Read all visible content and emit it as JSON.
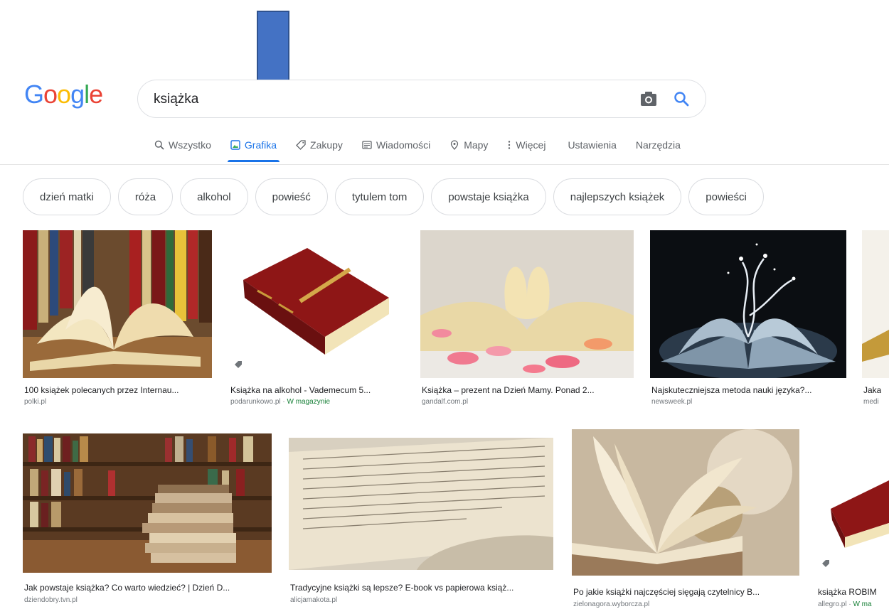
{
  "logo": {
    "text": "Google"
  },
  "search": {
    "value": "książka"
  },
  "tabs": [
    {
      "label": "Wszystko",
      "icon": "search-icon"
    },
    {
      "label": "Grafika",
      "icon": "image-icon"
    },
    {
      "label": "Zakupy",
      "icon": "tag-icon"
    },
    {
      "label": "Wiadomości",
      "icon": "news-icon"
    },
    {
      "label": "Mapy",
      "icon": "map-pin-icon"
    },
    {
      "label": "Więcej",
      "icon": "more-vert-icon"
    },
    {
      "label": "Ustawienia"
    },
    {
      "label": "Narzędzia"
    }
  ],
  "chips": [
    "dzień matki",
    "róża",
    "alkohol",
    "powieść",
    "tytulem tom",
    "powstaje książka",
    "najlepszych książek",
    "powieści"
  ],
  "results": [
    {
      "title": "100 książek polecanych przez Internau...",
      "source": "polki.pl",
      "stock": ""
    },
    {
      "title": "Książka na alkohol - Vademecum 5...",
      "source": "podarunkowo.pl · ",
      "stock": "W magazynie"
    },
    {
      "title": "Książka – prezent na Dzień Mamy. Ponad 2...",
      "source": "gandalf.com.pl",
      "stock": ""
    },
    {
      "title": "Najskuteczniejsza metoda nauki języka?...",
      "source": "newsweek.pl",
      "stock": ""
    },
    {
      "title": "Jaka",
      "source": "medi",
      "stock": ""
    },
    {
      "title": "Jak powstaje książka? Co warto wiedzieć? | Dzień D...",
      "source": "dziendobry.tvn.pl",
      "stock": ""
    },
    {
      "title": "Tradycyjne książki są lepsze? E-book vs papierowa książ...",
      "source": "alicjamakota.pl",
      "stock": ""
    },
    {
      "title": "Po jakie książki najczęściej sięgają czytelnicy B...",
      "source": "zielonagora.wyborcza.pl",
      "stock": ""
    },
    {
      "title": "książka ROBIM",
      "source": "allegro.pl · ",
      "stock": "W ma"
    }
  ],
  "colors": {
    "accent": "#1a73e8",
    "arrow": "#4472c4",
    "stock_green": "#188038"
  }
}
